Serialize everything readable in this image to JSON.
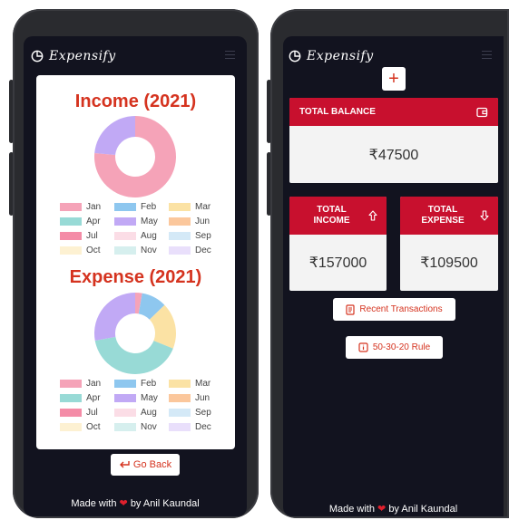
{
  "app": {
    "name": "Expensify"
  },
  "charts": {
    "chart_data": [
      {
        "type": "pie",
        "title": "Income (2021)",
        "categories": [
          "Jan",
          "Feb",
          "Mar",
          "Apr",
          "May",
          "Jun",
          "Jul",
          "Aug",
          "Sep",
          "Oct",
          "Nov",
          "Dec"
        ],
        "values": [
          120000,
          0,
          0,
          0,
          37000,
          0,
          0,
          0,
          0,
          0,
          0,
          0
        ],
        "colors": [
          "#f5a3b8",
          "#8ec7ef",
          "#fbe2a4",
          "#98dad6",
          "#c1a9f5",
          "#fbc79c",
          "#f48ca7",
          "#fbdde6",
          "#d4e9f7",
          "#fdf1d2",
          "#d6efee",
          "#e9dffb"
        ],
        "legend_position": "bottom"
      },
      {
        "type": "pie",
        "title": "Expense (2021)",
        "categories": [
          "Jan",
          "Feb",
          "Mar",
          "Apr",
          "May",
          "Jun",
          "Jul",
          "Aug",
          "Sep",
          "Oct",
          "Nov",
          "Dec"
        ],
        "values": [
          3000,
          11000,
          20000,
          45000,
          30500,
          0,
          0,
          0,
          0,
          0,
          0,
          0
        ],
        "colors": [
          "#f5a3b8",
          "#8ec7ef",
          "#fbe2a4",
          "#98dad6",
          "#c1a9f5",
          "#fbc79c",
          "#f48ca7",
          "#fbdde6",
          "#d4e9f7",
          "#fdf1d2",
          "#d6efee",
          "#e9dffb"
        ],
        "legend_position": "bottom"
      }
    ]
  },
  "left": {
    "go_back_label": "Go Back",
    "footer": {
      "prefix": "Made with",
      "heart": "❤",
      "suffix": "by Anil Kaundal"
    }
  },
  "right": {
    "add_label": "+",
    "balance": {
      "title": "TOTAL BALANCE",
      "value": "₹47500"
    },
    "income": {
      "title_line1": "TOTAL",
      "title_line2": "INCOME",
      "value": "₹157000"
    },
    "expense": {
      "title_line1": "TOTAL",
      "title_line2": "EXPENSE",
      "value": "₹109500"
    },
    "recent_label": "Recent Transactions",
    "rule_label": "50-30-20 Rule",
    "footer": {
      "prefix": "Made with",
      "heart": "❤",
      "suffix": "by Anil Kaundal"
    }
  },
  "theme": {
    "accent": "#c8102e",
    "title_red": "#d5331f",
    "screen_bg": "#12131f"
  }
}
